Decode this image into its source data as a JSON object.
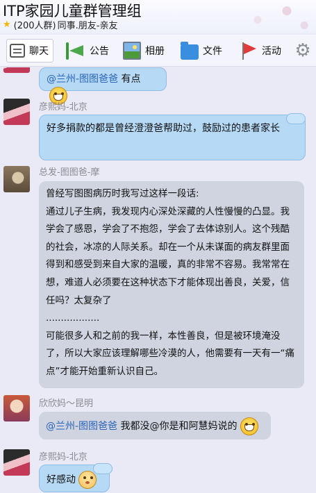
{
  "header": {
    "title": "ITP家园儿童群管理组",
    "member_count": "(200人群)",
    "tags": "同事.朋友-亲友"
  },
  "toolbar": {
    "items": [
      {
        "label": "聊天",
        "icon": "chat-icon",
        "active": true
      },
      {
        "label": "公告",
        "icon": "megaphone-icon"
      },
      {
        "label": "相册",
        "icon": "photo-album-icon"
      },
      {
        "label": "文件",
        "icon": "folder-icon"
      },
      {
        "label": "活动",
        "icon": "flag-icon"
      }
    ],
    "settings_icon": "gear-icon"
  },
  "messages": [
    {
      "sender": "",
      "mention": "@兰州-图图爸爸",
      "text": " 有点",
      "emoji": "grin-emoji"
    },
    {
      "sender": "彦熙妈-北京",
      "text": "好多捐款的都是曾经澄澄爸帮助过，鼓励过的患者家长"
    },
    {
      "sender": "总发-图图爸-摩",
      "paragraphs": [
        "曾经写图图病历时我写过这样一段话:",
        "通过儿子生病，我发现内心深处深藏的人性慢慢的凸显。我学会了感恩，学会了不抱怨，学会了去体谅别人。这个残酷的社会，冰凉的人际关系。却在一个从未谋面的病友群里面得到和感受到来自大家的温暖，真的非常不容易。我常常在想，难道人必须要在这种状态下才能体现出善良，关爱，信任吗？太复杂了",
        "..................",
        "可能很多人和之前的我一样，本性善良，但是被环境淹没了，所以大家应该理解哪些冷漠的人，他需要有一天有一“痛点”才能开始重新认识自己。"
      ]
    },
    {
      "sender": "欣欣妈～昆明",
      "mention": "@兰州-图图爸爸",
      "text": " 我都没@你是和阿慧妈说的",
      "emoji": "grin-emoji"
    },
    {
      "sender": "彦熙妈-北京",
      "text": "好感动",
      "emoji": "blush-emoji"
    }
  ]
}
